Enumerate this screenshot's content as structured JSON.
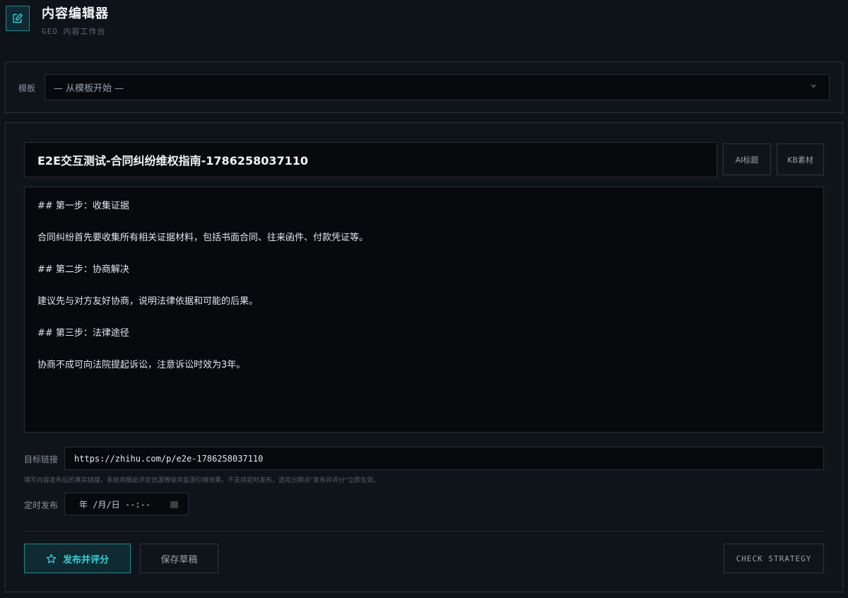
{
  "header": {
    "title": "内容编辑器",
    "subtitle": "GEO 内容工作台",
    "icon": "edit-icon"
  },
  "template": {
    "label": "模板",
    "selected": "— 从模板开始 —"
  },
  "editor": {
    "title_value": "E2E交互测试-合同纠纷维权指南-1786258037110",
    "ai_title_button": "AI标题",
    "kb_button": "KB素材",
    "body_lines": [
      "## 第一步：收集证据",
      "",
      "合同纠纷首先要收集所有相关证据材料，包括书面合同、往来函件、付款凭证等。",
      "",
      "## 第二步：协商解决",
      "",
      "建议先与对方友好协商，说明法律依据和可能的后果。",
      "",
      "## 第三步：法律途径",
      "",
      "协商不成可向法院提起诉讼，注意诉讼时效为3年。"
    ],
    "target_link_label": "目标链接",
    "target_link_value": "https://zhihu.com/p/e2e-1786258037110",
    "helper_text": "填写内容发布后的真实链接，系统将据此评定信源等级并监测引用效果。不支持定时发布，选完日期点\"发布并评分\"立即生效。",
    "schedule_label": "定时发布",
    "schedule_value": "年 /月/日 --:--"
  },
  "actions": {
    "publish": "发布并评分",
    "save_draft": "保存草稿",
    "check_strategy": "CHECK STRATEGY"
  },
  "colors": {
    "accent": "#2fd3df",
    "background": "#0e1219",
    "panel": "#0f141b"
  }
}
